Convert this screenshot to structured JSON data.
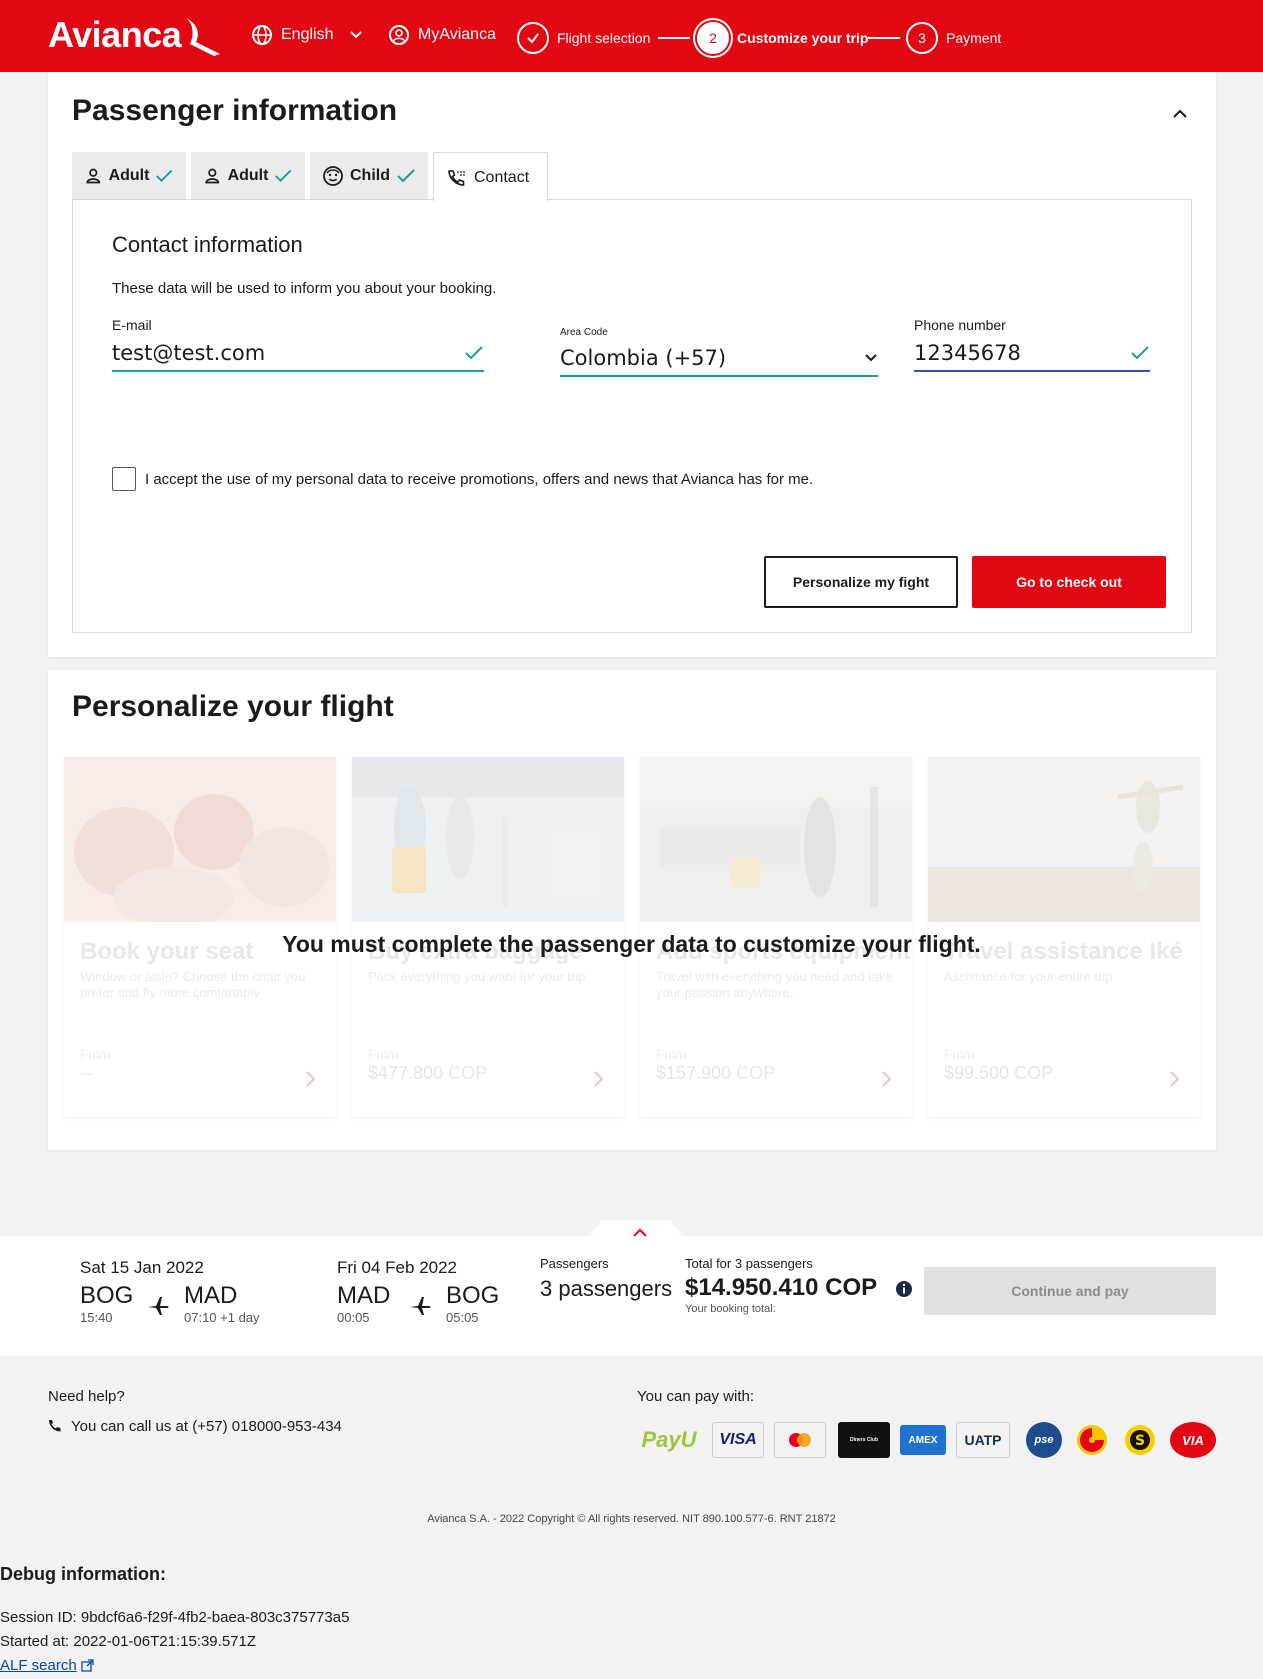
{
  "header": {
    "brand": "Avianca",
    "language": "English",
    "account": "MyAvianca",
    "steps": [
      {
        "number": "1",
        "label": "Flight selection",
        "state": "done"
      },
      {
        "number": "2",
        "label": "Customize your trip",
        "state": "active"
      },
      {
        "number": "3",
        "label": "Payment",
        "state": "pending"
      }
    ]
  },
  "passenger_info": {
    "title": "Passenger information",
    "tabs": [
      {
        "label": "Adult",
        "icon": "person-icon",
        "complete": true
      },
      {
        "label": "Adult",
        "icon": "person-icon",
        "complete": true
      },
      {
        "label": "Child",
        "icon": "child-face-icon",
        "complete": true
      },
      {
        "label": "Contact",
        "icon": "phone-icon",
        "complete": false
      }
    ],
    "contact": {
      "heading": "Contact information",
      "description": "These data will be used to inform you about your booking.",
      "email_label": "E-mail",
      "email_value": "test@test.com",
      "area_code_label": "Area Code",
      "area_code_value": "Colombia (+57)",
      "phone_label": "Phone number",
      "phone_value": "12345678",
      "consent_text": "I accept the use of my personal data to receive promotions, offers and news that Avianca has for me.",
      "consent_checked": false,
      "personalize_button": "Personalize my fight",
      "checkout_button": "Go to check out"
    }
  },
  "personalize": {
    "title": "Personalize your flight",
    "overlay_message": "You must complete the passenger data to customize your flight.",
    "cards": [
      {
        "title": "Book your seat",
        "description": "Window or aisle? Choose the chair you prefer and fly more comfortably.",
        "from_label": "From",
        "price": "--"
      },
      {
        "title": "Buy extra baggage",
        "description": "Pack everything you want for your trip.",
        "from_label": "From",
        "price": "$477.800 COP"
      },
      {
        "title": "Add sports equipment",
        "description": "Travel with everything you need and take your passion anywhere.",
        "from_label": "From",
        "price": "$157.900 COP"
      },
      {
        "title": "Travel assistance Iké",
        "description": "Assistance for your entire trip",
        "from_label": "From",
        "price": "$99.500 COP"
      }
    ]
  },
  "summary": {
    "outbound": {
      "date": "Sat 15 Jan 2022",
      "from": "BOG",
      "from_time": "15:40",
      "to": "MAD",
      "to_time": "07:10 +1 day"
    },
    "return": {
      "date": "Fri 04 Feb 2022",
      "from": "MAD",
      "from_time": "00:05",
      "to": "BOG",
      "to_time": "05:05"
    },
    "passengers_label": "Passengers",
    "passengers_value": "3 passengers",
    "total_label": "Total for 3 passengers",
    "total_value": "$14.950.410 COP",
    "total_sub": "Your booking total:",
    "continue_button": "Continue and pay"
  },
  "footer": {
    "help_title": "Need help?",
    "help_phone": "You can call us at (+57) 018000-953-434",
    "pay_title": "You can pay with:",
    "pay_methods": [
      "PayU",
      "VISA",
      "Mastercard",
      "Diners Club",
      "AMEX",
      "UATP",
      "pse",
      "Efecty",
      "Servientrega",
      "VIA"
    ],
    "copyright": "Avianca S.A. - 2022 Copyright © All rights reserved. NIT 890.100.577-6. RNT 21872"
  },
  "debug": {
    "title": "Debug information:",
    "session": "Session ID: 9bdcf6a6-f29f-4fb2-baea-803c375773a5",
    "started": "Started at: 2022-01-06T21:15:39.571Z",
    "link": "ALF search"
  },
  "colors": {
    "brand_red": "#e30613",
    "teal_check": "#1a9c9c",
    "phone_underline": "#3b4bc8"
  }
}
